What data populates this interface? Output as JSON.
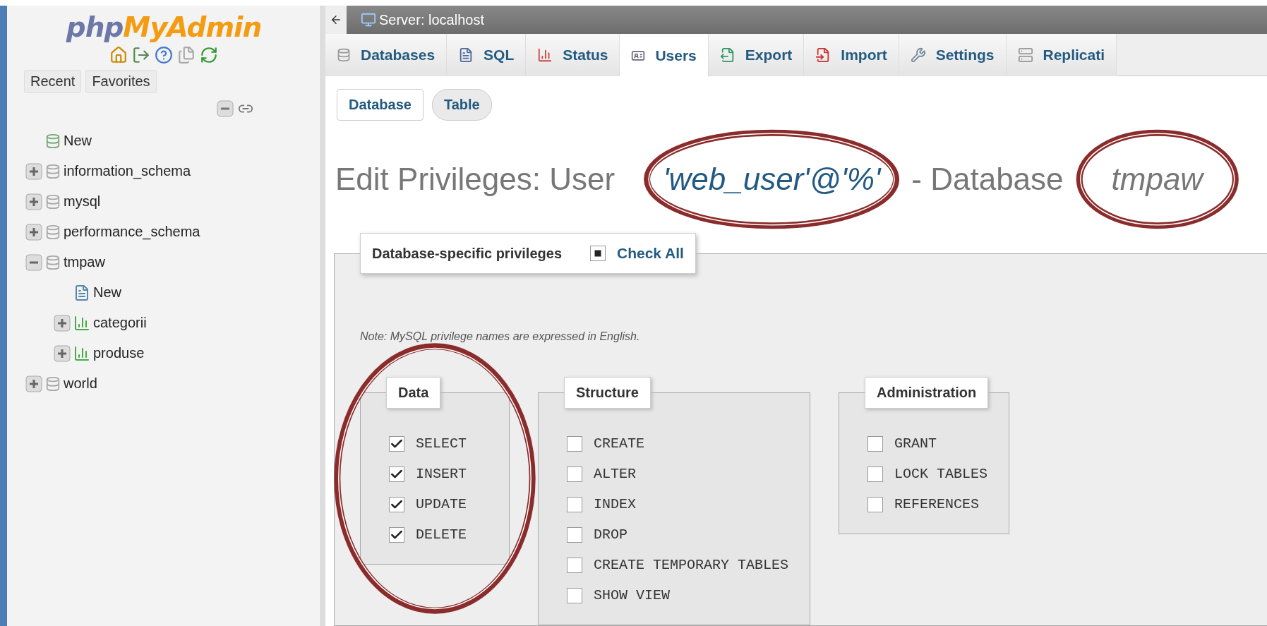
{
  "logo": {
    "part_1": "php",
    "part_2": "MyAdmin"
  },
  "sidebar": {
    "tabs": [
      "Recent",
      "Favorites"
    ],
    "tree": [
      {
        "label": "New",
        "kind": "new"
      },
      {
        "label": "information_schema",
        "kind": "database",
        "expanded": false
      },
      {
        "label": "mysql",
        "kind": "database",
        "expanded": false
      },
      {
        "label": "performance_schema",
        "kind": "database",
        "expanded": false
      },
      {
        "label": "tmpaw",
        "kind": "database",
        "expanded": true,
        "children": [
          {
            "label": "New",
            "kind": "new-table"
          },
          {
            "label": "categorii",
            "kind": "table",
            "expanded": false
          },
          {
            "label": "produse",
            "kind": "table",
            "expanded": false
          }
        ]
      },
      {
        "label": "world",
        "kind": "database",
        "expanded": false
      }
    ]
  },
  "breadcrumb": "Server: localhost",
  "tabs": [
    {
      "label": "Databases",
      "selected": false
    },
    {
      "label": "SQL",
      "selected": false
    },
    {
      "label": "Status",
      "selected": false
    },
    {
      "label": "Users",
      "selected": true
    },
    {
      "label": "Export",
      "selected": false
    },
    {
      "label": "Import",
      "selected": false
    },
    {
      "label": "Settings",
      "selected": false
    },
    {
      "label": "Replicati",
      "selected": false
    }
  ],
  "subtabs": [
    {
      "label": "Database",
      "selected": true
    },
    {
      "label": "Table",
      "selected": false
    }
  ],
  "title": {
    "prefix": "Edit Privileges: User",
    "user": "'web_user'@'%'",
    "middle": "- Database",
    "database": "tmpaw"
  },
  "privileges": {
    "legend": "Database-specific privileges",
    "check_all": "Check All",
    "note": "Note: MySQL privilege names are expressed in English.",
    "groups": [
      {
        "legend": "Data",
        "highlighted": true,
        "items": [
          {
            "label": "SELECT",
            "checked": true
          },
          {
            "label": "INSERT",
            "checked": true
          },
          {
            "label": "UPDATE",
            "checked": true
          },
          {
            "label": "DELETE",
            "checked": true
          }
        ]
      },
      {
        "legend": "Structure",
        "highlighted": false,
        "items": [
          {
            "label": "CREATE",
            "checked": false
          },
          {
            "label": "ALTER",
            "checked": false
          },
          {
            "label": "INDEX",
            "checked": false
          },
          {
            "label": "DROP",
            "checked": false
          },
          {
            "label": "CREATE TEMPORARY TABLES",
            "checked": false
          },
          {
            "label": "SHOW VIEW",
            "checked": false
          }
        ]
      },
      {
        "legend": "Administration",
        "highlighted": false,
        "items": [
          {
            "label": "GRANT",
            "checked": false
          },
          {
            "label": "LOCK TABLES",
            "checked": false
          },
          {
            "label": "REFERENCES",
            "checked": false
          }
        ]
      }
    ]
  }
}
